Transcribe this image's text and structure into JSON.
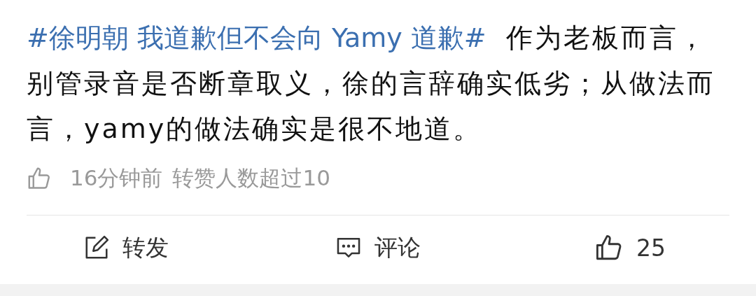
{
  "post": {
    "hashtag": "#徐明朝 我道歉但不会向 Yamy 道歉#",
    "text": "作为老板而言，别管录音是否断章取义，徐的言辞确实低劣；从做法而言，yamy的做法确实是很不地道。"
  },
  "meta": {
    "time": "16分钟前",
    "note": "转赞人数超过10"
  },
  "actions": [
    {
      "kind": "repost",
      "label": "转发"
    },
    {
      "kind": "comment",
      "label": "评论"
    },
    {
      "kind": "like",
      "label": "25"
    }
  ]
}
